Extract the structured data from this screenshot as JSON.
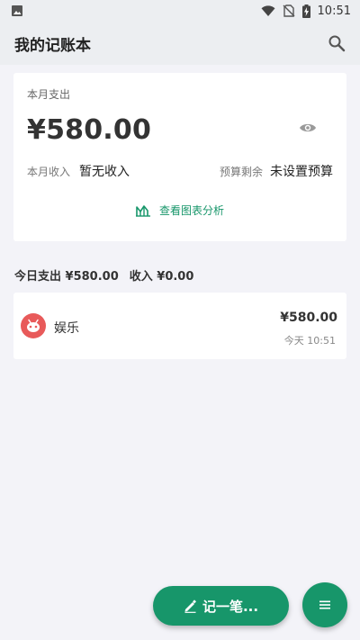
{
  "status_bar": {
    "time": "10:51",
    "icons": [
      "image-icon",
      "wifi-icon",
      "no-sim-icon",
      "battery-charging-icon"
    ]
  },
  "app_bar": {
    "title": "我的记账本",
    "search_icon": "search-icon"
  },
  "summary": {
    "month_label": "本月支出",
    "month_amount": "¥580.00",
    "income_label": "本月收入",
    "income_value": "暂无收入",
    "budget_label": "预算剩余",
    "budget_value": "未设置预算",
    "chart_link_label": "查看图表分析",
    "eye_icon": "eye-icon",
    "chart_icon": "chart-icon"
  },
  "today": {
    "expense_text": "今日支出 ¥580.00",
    "income_text": "收入 ¥0.00"
  },
  "transactions": [
    {
      "category": "娱乐",
      "amount": "¥580.00",
      "time": "今天 10:51",
      "icon": "entertainment-icon",
      "icon_color": "#e85a5a"
    }
  ],
  "fab": {
    "record_label": "记一笔...",
    "record_icon": "pencil-icon",
    "menu_icon": "menu-icon"
  },
  "colors": {
    "accent": "#17966a",
    "background": "#f3f3f8",
    "bar": "#eceef1"
  }
}
